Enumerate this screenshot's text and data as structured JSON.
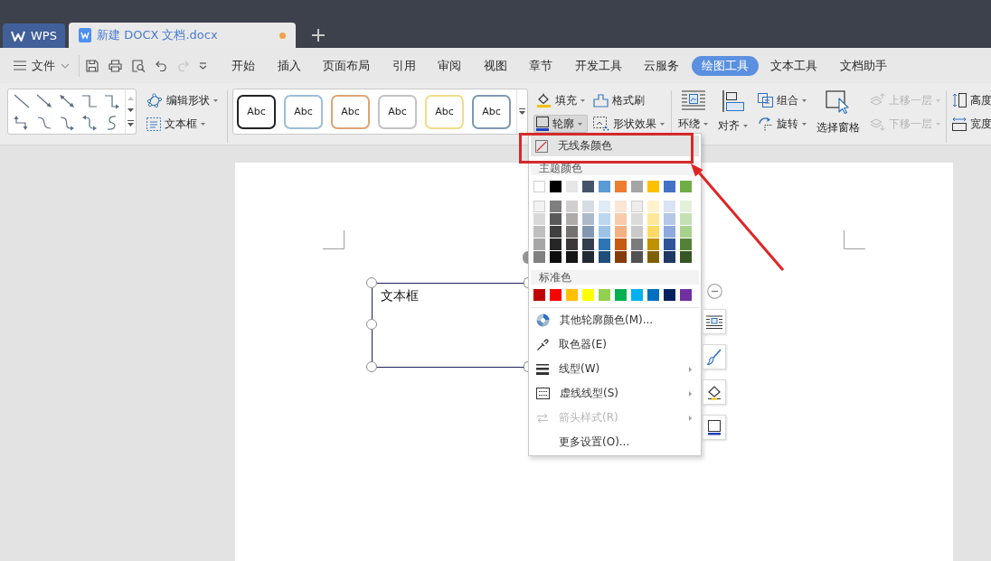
{
  "title_bar": {
    "tabs": [
      {
        "kind": "home",
        "label": "WPS",
        "selected": false,
        "unsaved": false
      },
      {
        "kind": "document",
        "label": "新建 DOCX 文档.docx",
        "selected": true,
        "unsaved": true
      }
    ]
  },
  "menu_bar": {
    "file_menu": "文件",
    "quick_tools": [
      {
        "kind": "save",
        "disabled": false
      },
      {
        "kind": "print",
        "disabled": false
      },
      {
        "kind": "preview",
        "disabled": false
      },
      {
        "kind": "undo",
        "disabled": false
      },
      {
        "kind": "redo",
        "disabled": true
      },
      {
        "kind": "customize",
        "disabled": false
      }
    ],
    "tabs": [
      {
        "label": "开始",
        "selected": false
      },
      {
        "label": "插入",
        "selected": false
      },
      {
        "label": "页面布局",
        "selected": false
      },
      {
        "label": "引用",
        "selected": false
      },
      {
        "label": "审阅",
        "selected": false
      },
      {
        "label": "视图",
        "selected": false
      },
      {
        "label": "章节",
        "selected": false
      },
      {
        "label": "开发工具",
        "selected": false
      },
      {
        "label": "云服务",
        "selected": false
      },
      {
        "label": "绘图工具",
        "selected": true
      },
      {
        "label": "文本工具",
        "selected": false
      },
      {
        "label": "文档助手",
        "selected": false
      }
    ]
  },
  "ribbon": {
    "shape_tools": [
      {
        "kind": "edit_shape",
        "label": "编辑形状",
        "dropdown": true
      },
      {
        "kind": "text_box",
        "label": "文本框",
        "dropdown": true
      }
    ],
    "style_presets": [
      {
        "label": "Abc",
        "color": "#222222"
      },
      {
        "label": "Abc",
        "color": "#9dbdd8"
      },
      {
        "label": "Abc",
        "color": "#dba578"
      },
      {
        "label": "Abc",
        "color": "#c3c3c3"
      },
      {
        "label": "Abc",
        "color": "#f0dc8a"
      },
      {
        "label": "Abc",
        "color": "#7f99b3"
      }
    ],
    "format_tools": [
      {
        "kind": "fill",
        "label": "填充",
        "dropdown": true,
        "expanded": false
      },
      {
        "kind": "format_painter",
        "label": "格式刷",
        "dropdown": false,
        "expanded": false
      },
      {
        "kind": "outline",
        "label": "轮廓",
        "dropdown": true,
        "expanded": true
      },
      {
        "kind": "effects",
        "label": "形状效果",
        "dropdown": true,
        "expanded": false
      }
    ],
    "arrange_tools": [
      {
        "kind": "wrap",
        "label": "环绕",
        "dropdown": true,
        "disabled": false
      },
      {
        "kind": "align",
        "label": "对齐",
        "dropdown": true,
        "disabled": false
      },
      {
        "kind": "group",
        "label": "组合",
        "dropdown": true,
        "disabled": false
      },
      {
        "kind": "rotate",
        "label": "旋转",
        "dropdown": true,
        "disabled": false
      },
      {
        "kind": "selection_pane",
        "label": "选择窗格",
        "dropdown": false,
        "disabled": false
      },
      {
        "kind": "bring_forward",
        "label": "上移一层",
        "dropdown": true,
        "disabled": true
      },
      {
        "kind": "send_backward",
        "label": "下移一层",
        "dropdown": true,
        "disabled": true
      }
    ],
    "size_tools": [
      {
        "kind": "height",
        "label": "高度"
      },
      {
        "kind": "width",
        "label": "宽度"
      }
    ]
  },
  "document": {
    "text_box": {
      "text": "文本框",
      "selected": true
    }
  },
  "outline_menu": {
    "no_color": {
      "label": "无线条颜色",
      "highlighted": true
    },
    "theme_heading": "主题颜色",
    "theme_colors": [
      {
        "color": "#ffffff"
      },
      {
        "color": "#000000"
      },
      {
        "color": "#e7e6e6"
      },
      {
        "color": "#44546a"
      },
      {
        "color": "#5b9bd5"
      },
      {
        "color": "#ed7d31"
      },
      {
        "color": "#a5a5a5"
      },
      {
        "color": "#ffc000"
      },
      {
        "color": "#4472c4"
      },
      {
        "color": "#70ad47"
      }
    ],
    "theme_shades": [
      {
        "swatches": [
          {
            "color": "#f2f2f2"
          },
          {
            "color": "#7f7f7f"
          },
          {
            "color": "#d0cece"
          },
          {
            "color": "#d6dce4"
          },
          {
            "color": "#deebf6"
          },
          {
            "color": "#fbe5d5"
          },
          {
            "color": "#ededed"
          },
          {
            "color": "#fff2cc"
          },
          {
            "color": "#dae3f3"
          },
          {
            "color": "#e2f0d9"
          }
        ]
      },
      {
        "swatches": [
          {
            "color": "#d9d9d9"
          },
          {
            "color": "#595959"
          },
          {
            "color": "#aeabab"
          },
          {
            "color": "#adb9ca"
          },
          {
            "color": "#bdd7ee"
          },
          {
            "color": "#f7cbac"
          },
          {
            "color": "#dbdbdb"
          },
          {
            "color": "#ffe699"
          },
          {
            "color": "#b4c7e7"
          },
          {
            "color": "#c5e0b4"
          }
        ]
      },
      {
        "swatches": [
          {
            "color": "#bfbfbf"
          },
          {
            "color": "#404040"
          },
          {
            "color": "#757171"
          },
          {
            "color": "#8497b0"
          },
          {
            "color": "#9dc3e6"
          },
          {
            "color": "#f4b183"
          },
          {
            "color": "#c9c9c9"
          },
          {
            "color": "#ffd965"
          },
          {
            "color": "#8faadc"
          },
          {
            "color": "#a9d18e"
          }
        ]
      },
      {
        "swatches": [
          {
            "color": "#a6a6a6"
          },
          {
            "color": "#262626"
          },
          {
            "color": "#3a3838"
          },
          {
            "color": "#333f4f"
          },
          {
            "color": "#2e75b5"
          },
          {
            "color": "#c55a11"
          },
          {
            "color": "#7b7b7b"
          },
          {
            "color": "#bf9000"
          },
          {
            "color": "#2f5597"
          },
          {
            "color": "#538135"
          }
        ]
      },
      {
        "swatches": [
          {
            "color": "#808080"
          },
          {
            "color": "#0d0d0d"
          },
          {
            "color": "#161616"
          },
          {
            "color": "#222a35"
          },
          {
            "color": "#1f4e79"
          },
          {
            "color": "#843c0b"
          },
          {
            "color": "#525252"
          },
          {
            "color": "#7f6000"
          },
          {
            "color": "#203864"
          },
          {
            "color": "#375623"
          }
        ]
      }
    ],
    "standard_heading": "标准色",
    "standard_colors": [
      {
        "color": "#c00000"
      },
      {
        "color": "#ff0000"
      },
      {
        "color": "#ffc000"
      },
      {
        "color": "#ffff00"
      },
      {
        "color": "#92d050"
      },
      {
        "color": "#00b050"
      },
      {
        "color": "#00b0f0"
      },
      {
        "color": "#0070c0"
      },
      {
        "color": "#002060"
      },
      {
        "color": "#7030a0"
      }
    ],
    "items": [
      {
        "kind": "more_colors",
        "label": "其他轮廓颜色(M)...",
        "submenu": false,
        "disabled": false
      },
      {
        "kind": "eyedropper",
        "label": "取色器(E)",
        "submenu": false,
        "disabled": false
      },
      {
        "kind": "weight",
        "label": "线型(W)",
        "submenu": true,
        "disabled": false
      },
      {
        "kind": "dash",
        "label": "虚线线型(S)",
        "submenu": true,
        "disabled": false
      },
      {
        "kind": "arrows",
        "label": "箭头样式(R)",
        "submenu": true,
        "disabled": true
      },
      {
        "kind": "settings",
        "label": "更多设置(O)...",
        "submenu": false,
        "disabled": false
      }
    ]
  }
}
